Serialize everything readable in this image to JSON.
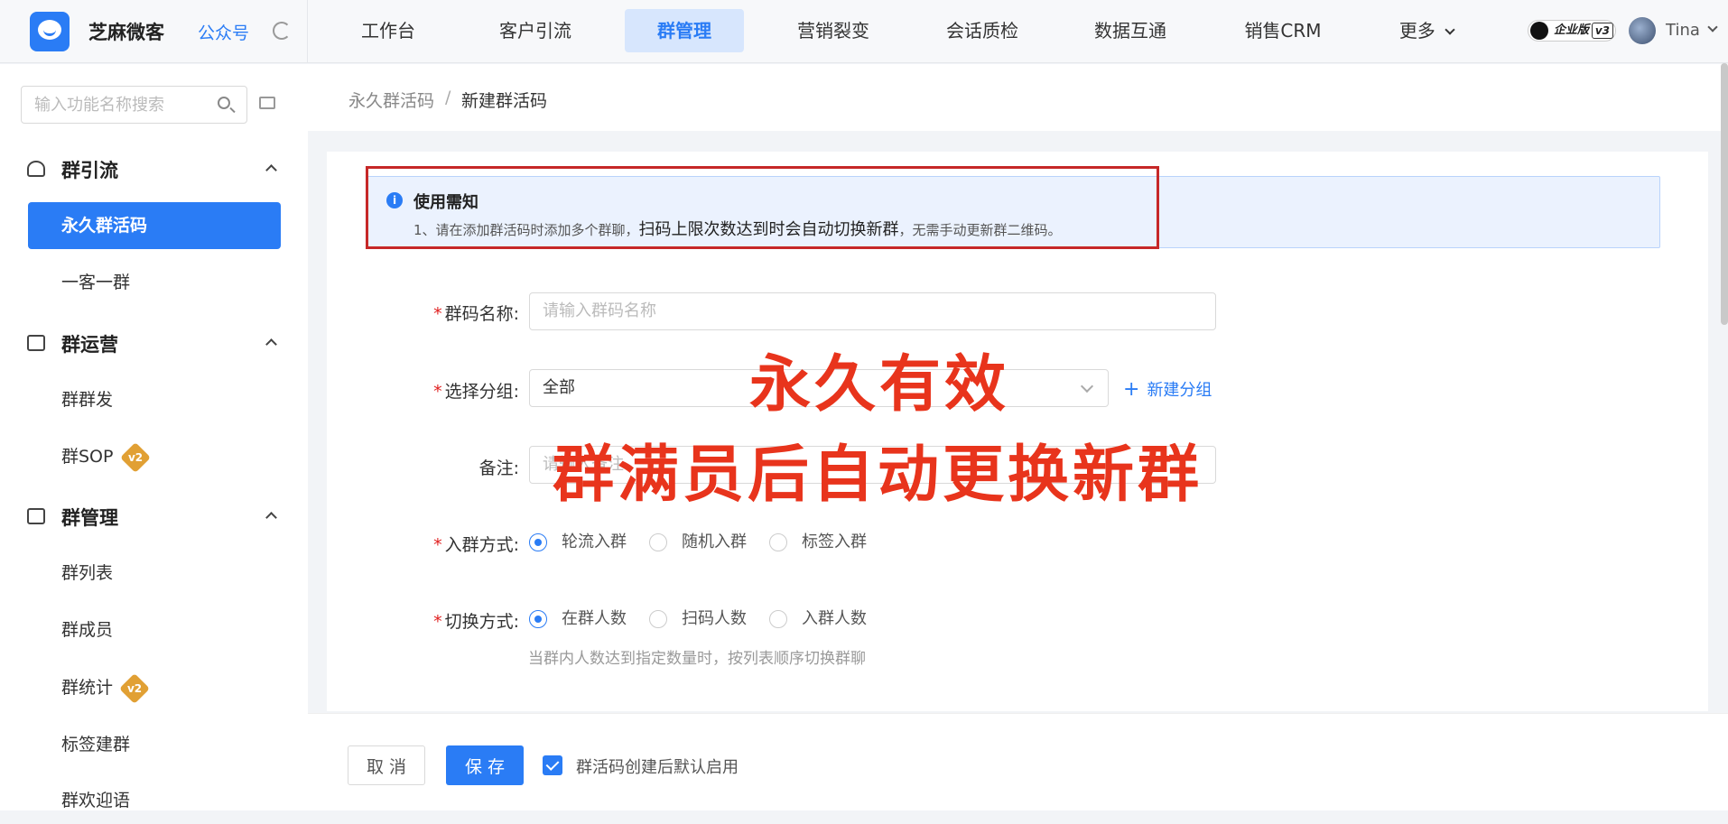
{
  "header": {
    "brand": "芝麻微客",
    "gzh": "公众号",
    "nav": [
      "工作台",
      "客户引流",
      "群管理",
      "营销裂变",
      "会话质检",
      "数据互通",
      "销售CRM",
      "更多"
    ],
    "active_nav": "群管理",
    "edition": "企业版",
    "edition_version": "v3",
    "user": "Tina"
  },
  "sidebar": {
    "search_placeholder": "输入功能名称搜索",
    "groups": [
      {
        "title": "群引流",
        "items": [
          "永久群活码",
          "一客一群"
        ]
      },
      {
        "title": "群运营",
        "items": [
          "群群发",
          "群SOP"
        ]
      },
      {
        "title": "群管理",
        "items": [
          "群列表",
          "群成员",
          "群统计",
          "标签建群",
          "群欢迎语"
        ]
      }
    ],
    "active_item": "永久群活码",
    "version_badge": "v2"
  },
  "breadcrumb": {
    "parent": "永久群活码",
    "sep": "/",
    "current": "新建群活码"
  },
  "notice": {
    "title": "使用需知",
    "text_a": "1、请在添加群活码时添加多个群聊，",
    "text_b": "扫码上限次数达到时会自动切换新群",
    "text_c": "，无需手动更新群二维码。"
  },
  "form": {
    "name_label": "群码名称:",
    "name_placeholder": "请输入群码名称",
    "group_label": "选择分组:",
    "group_value": "全部",
    "new_group": "新建分组",
    "remark_label": "备注:",
    "remark_placeholder": "请输入备注",
    "join_label": "入群方式:",
    "join_options": [
      "轮流入群",
      "随机入群",
      "标签入群"
    ],
    "join_selected": "轮流入群",
    "switch_label": "切换方式:",
    "switch_options": [
      "在群人数",
      "扫码人数",
      "入群人数"
    ],
    "switch_selected": "在群人数",
    "switch_hint": "当群内人数达到指定数量时，按列表顺序切换群聊"
  },
  "overlay": {
    "line1": "永久有效",
    "line2": "群满员后自动更换新群"
  },
  "footer": {
    "cancel": "取 消",
    "save": "保 存",
    "checkbox_label": "群活码创建后默认启用"
  },
  "colors": {
    "accent": "#2a7cf5",
    "overlay_red": "#e8341c",
    "highlight_box": "#c62828"
  }
}
